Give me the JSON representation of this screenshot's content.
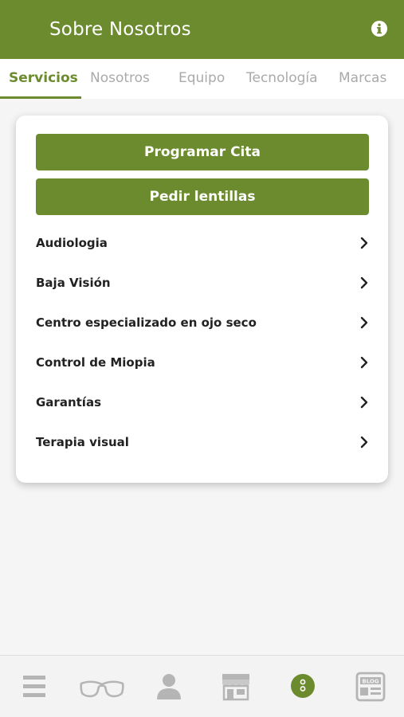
{
  "header": {
    "title": "Sobre Nosotros",
    "info_icon": "info-circle-icon"
  },
  "tabs": [
    {
      "label": "Servicios",
      "active": true
    },
    {
      "label": "Nosotros",
      "active": false
    },
    {
      "label": "Equipo",
      "active": false
    },
    {
      "label": "Tecnología",
      "active": false
    },
    {
      "label": "Marcas",
      "active": false
    }
  ],
  "buttons": {
    "appointment_label": "Programar Cita",
    "lenses_label": "Pedir lentillas"
  },
  "services": [
    {
      "label": "Audiologia"
    },
    {
      "label": "Baja Visión"
    },
    {
      "label": "Centro especializado en ojo seco"
    },
    {
      "label": "Control de Miopia"
    },
    {
      "label": "Garantías"
    },
    {
      "label": "Terapia visual"
    }
  ],
  "bottom_nav": [
    {
      "icon": "menu-icon",
      "active": false
    },
    {
      "icon": "glasses-icon",
      "active": false
    },
    {
      "icon": "user-icon",
      "active": false
    },
    {
      "icon": "store-icon",
      "active": false
    },
    {
      "icon": "about-icon",
      "active": true
    },
    {
      "icon": "blog-icon",
      "active": false
    }
  ],
  "colors": {
    "brand": "#6b8b2e",
    "inactive": "#aaaaaa",
    "text": "#222222"
  }
}
